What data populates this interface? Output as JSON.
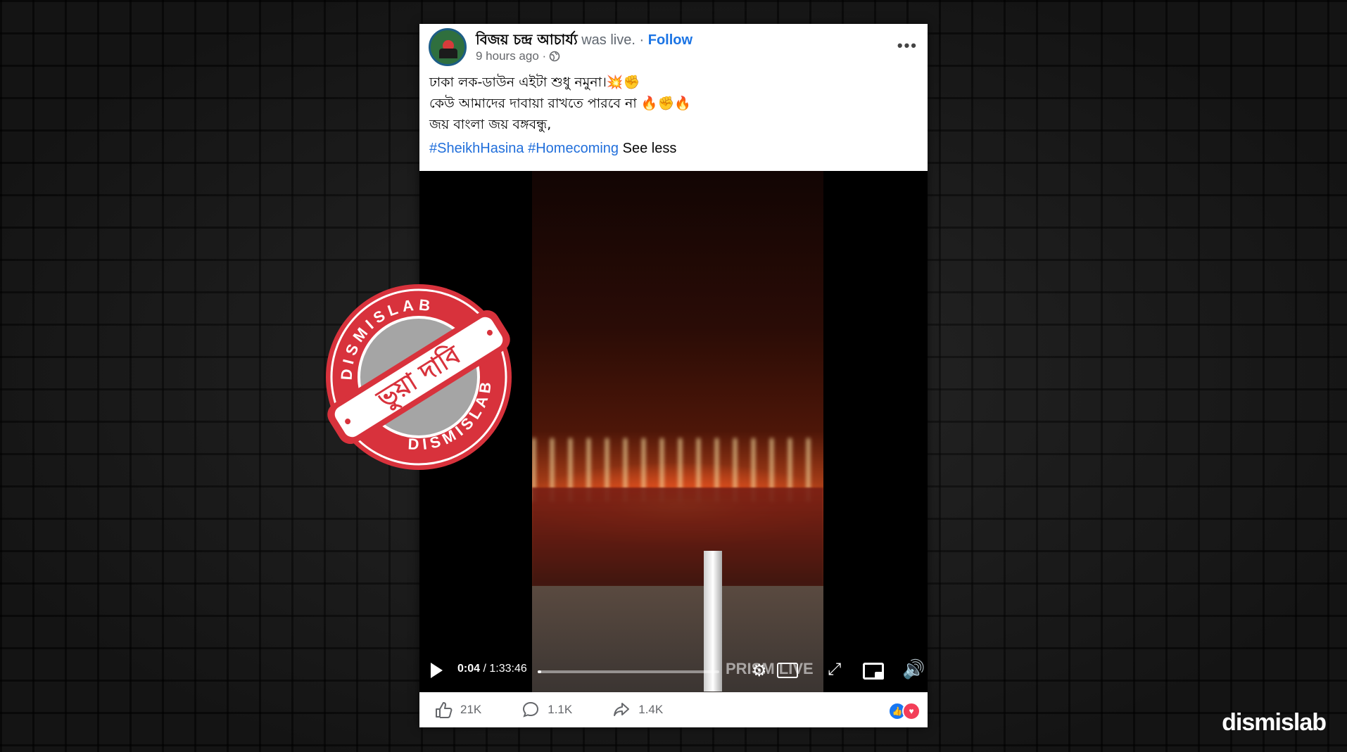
{
  "post": {
    "author": "বিজয় চন্দ্র আচার্য্য",
    "status": "was live.",
    "separator": "·",
    "follow_label": "Follow",
    "time_ago": "9 hours ago ·",
    "globe_icon": "globe-icon",
    "more_icon": "more-options-icon",
    "text_lines": [
      "ঢাকা লক-ডাউন এইটা শুধু নমুনা।💥✊",
      "কেউ আমাদের দাবায়া রাখতে পারবে না 🔥✊🔥",
      "জয় বাংলা জয় বঙ্গবন্ধু,"
    ],
    "hashtags": [
      "#SheikhHasina",
      "#Homecoming"
    ],
    "see_less": "See less"
  },
  "video": {
    "current_time": "0:04",
    "total_time": "1:33:46",
    "progress": 0.02,
    "watermark": "PRISM LIVE",
    "icons": [
      "play-icon",
      "settings-icon",
      "live-icon",
      "fullscreen-icon",
      "pip-icon",
      "volume-icon"
    ]
  },
  "actions": {
    "likes": "21K",
    "comments": "1.1K",
    "shares": "1.4K",
    "reactions": [
      "like",
      "love"
    ]
  },
  "stamp": {
    "ring_text_top": "DISMISLAB",
    "ring_text_bottom": "DISMISLAB",
    "banner": "ভুয়া দাবি",
    "colors": {
      "red": "#d8323c",
      "gray": "#a5a5a5",
      "white": "#ffffff"
    }
  },
  "brand": "dismislab"
}
